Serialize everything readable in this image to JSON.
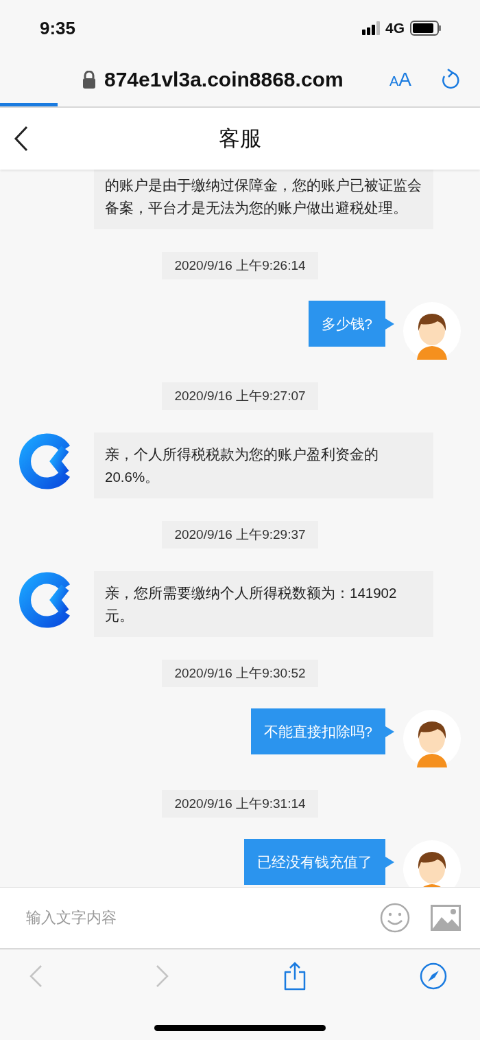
{
  "status_bar": {
    "time": "9:35",
    "network": "4G"
  },
  "browser": {
    "url": "874e1vl3a.coin8868.com",
    "text_size": "AA",
    "load_progress": {
      "level": 0.12
    }
  },
  "header": {
    "title": "客服"
  },
  "messages": [
    {
      "kind": "received",
      "lines": [
        "的账户是由于缴纳过保障金，您的账户已被证监会",
        "备案，平台才是无法为您的账户做出避税处理。"
      ]
    },
    {
      "kind": "time",
      "text": "2020/9/16 上午9:26:14"
    },
    {
      "kind": "sent",
      "lines": [
        "多少钱?"
      ]
    },
    {
      "kind": "time",
      "text": "2020/9/16 上午9:27:07"
    },
    {
      "kind": "received",
      "lines": [
        "亲，个人所得税税款为您的账户盈利资金的",
        "20.6%。"
      ]
    },
    {
      "kind": "time",
      "text": "2020/9/16 上午9:29:37"
    },
    {
      "kind": "received",
      "lines": [
        "亲，您所需要缴纳个人所得税数额为：141902",
        "元。"
      ]
    },
    {
      "kind": "time",
      "text": "2020/9/16 上午9:30:52"
    },
    {
      "kind": "sent",
      "lines": [
        "不能直接扣除吗?"
      ]
    },
    {
      "kind": "time",
      "text": "2020/9/16 上午9:31:14"
    },
    {
      "kind": "sent",
      "lines": [
        "已经没有钱充值了"
      ]
    }
  ],
  "input": {
    "placeholder": "输入文字内容"
  },
  "toolbar": {
    "back": {
      "disabled": true
    },
    "forward": {
      "disabled": true
    }
  }
}
